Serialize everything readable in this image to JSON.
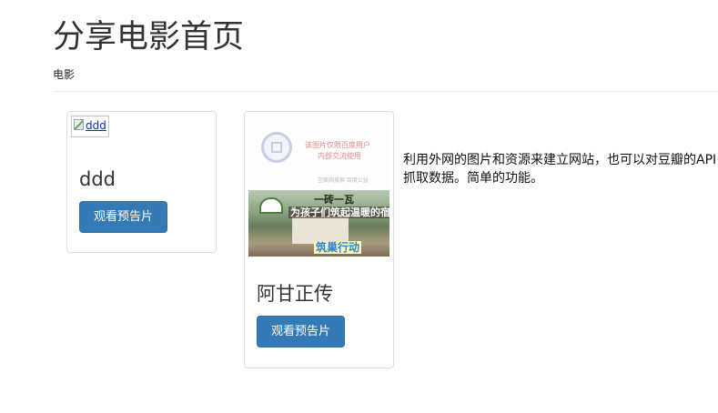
{
  "header": {
    "title": "分享电影首页",
    "nav_link": "电影"
  },
  "movies": [
    {
      "title": "ddd",
      "image_alt": "ddd",
      "button_label": "观看预告片"
    },
    {
      "title": "阿甘正传",
      "button_label": "观看预告片",
      "poster": {
        "note_line1": "该图片仅限百度用户",
        "note_line2": "内部交流使用",
        "source": "互联网搜索 百度公益",
        "headline_line1": "一砖一瓦",
        "headline_line2": "为孩子们筑起温暖的宿舍",
        "slogan": "筑巢行动"
      }
    }
  ],
  "intro": {
    "text": "利用外网的图片和资源来建立网站，也可以对豆瓣的API抓取数据。简单的功能。"
  },
  "colors": {
    "primary_button": "#337ab7",
    "card_border": "#dddddd",
    "divider": "#eeeeee"
  }
}
